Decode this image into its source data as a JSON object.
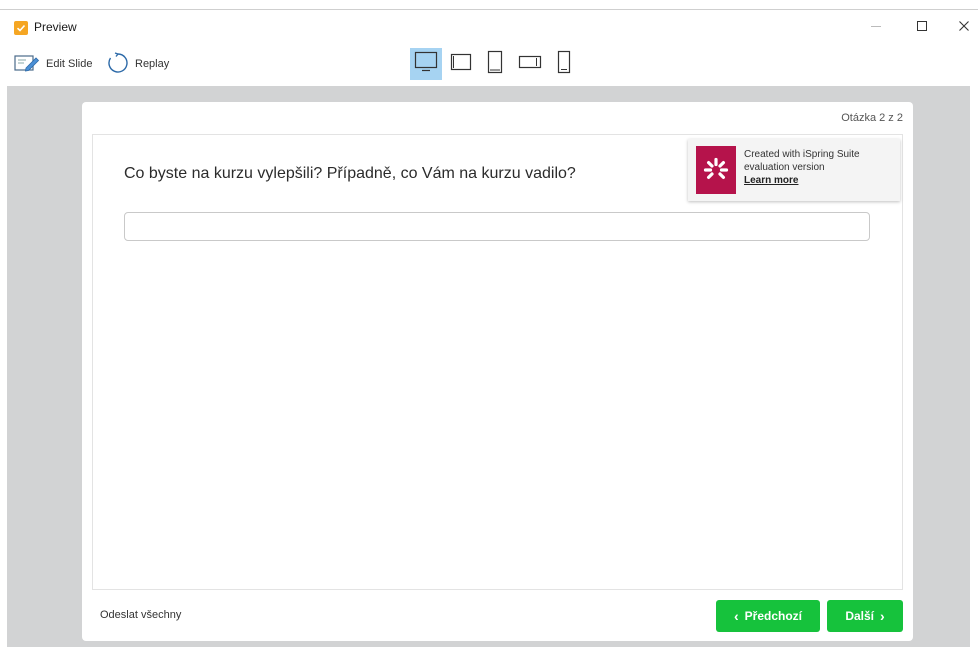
{
  "window": {
    "title": "Preview"
  },
  "toolbar": {
    "edit_slide": "Edit Slide",
    "replay": "Replay"
  },
  "devices": [
    "desktop-icon",
    "tablet-landscape-icon",
    "tablet-portrait-icon",
    "phone-landscape-icon",
    "phone-portrait-icon"
  ],
  "quiz": {
    "counter": "Otázka 2 z 2",
    "question": "Co byste na kurzu vylepšili? Případně, co Vám na kurzu vadilo?",
    "answer_value": "",
    "submit_all": "Odeslat všechny",
    "prev_label": "Předchozí",
    "next_label": "Další"
  },
  "promo": {
    "line1": "Created with iSpring Suite",
    "line2": "evaluation version",
    "link": "Learn more"
  },
  "colors": {
    "accent_green": "#16c23c",
    "device_active": "#a6d3f2",
    "promo_logo": "#b5134b",
    "app_icon": "#f5a623"
  }
}
